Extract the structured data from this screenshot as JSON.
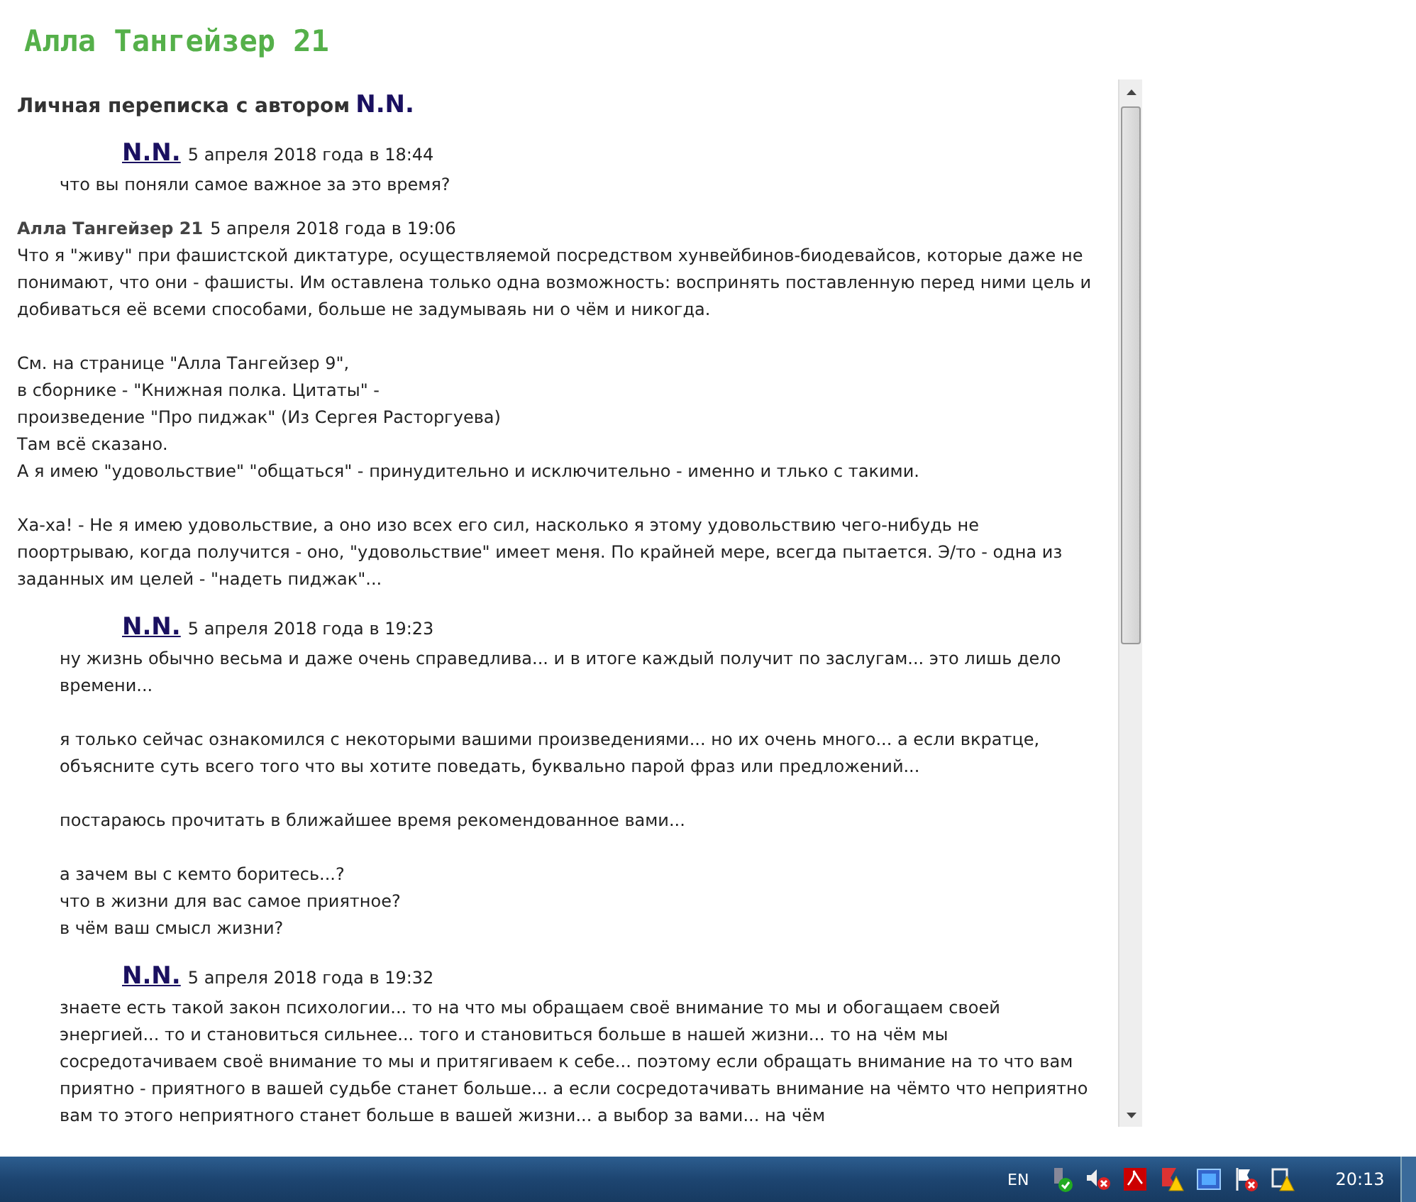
{
  "page_title": "Алла Тангейзер 21",
  "heading": {
    "text": "Личная переписка с автором",
    "author": "N.N."
  },
  "messages": [
    {
      "kind": "reply",
      "author": "N.N.",
      "date": "5 апреля 2018 года в 18:44",
      "paragraphs": [
        [
          "что вы поняли самое важное за это время?"
        ]
      ]
    },
    {
      "kind": "own",
      "author": "Алла Тангейзер 21",
      "date": "5 апреля 2018 года в 19:06",
      "paragraphs": [
        [
          "Что я \"живу\" при фашистской диктатуре, осуществляемой посредством хунвейбинов-биодевайсов, которые даже не понимают, что они - фашисты. Им оставлена только одна возможность: воспринять поставленную перед ними цель и добиваться её всеми способами, больше не задумываяь ни о чём и никогда."
        ],
        [
          "См. на странице \"Алла Тангейзер 9\",",
          "в сборнике - \"Книжная полка. Цитаты\" -",
          "произведение \"Про пиджак\" (Из Сергея Расторгуева)",
          "Там всё сказано.",
          "А я имею \"удовольствие\" \"общаться\" - принудительно и исключительно - именно и тлько с такими."
        ],
        [
          "Ха-ха! - Не я имею удовольствие, а оно изо всех его сил, насколько я этому удовольствию чего-нибудь не поортрываю, когда получится - оно, \"удовольствие\" имеет меня. По крайней мере, всегда пытается. Э/то - одна из заданных им целей - \"надеть пиджак\"..."
        ]
      ]
    },
    {
      "kind": "reply",
      "author": "N.N.",
      "date": "5 апреля 2018 года в 19:23",
      "paragraphs": [
        [
          "ну жизнь обычно весьма и даже очень справедлива... и в итоге каждый получит по заслугам... это лишь дело времени..."
        ],
        [
          "я только сейчас ознакомился с некоторыми вашими произведениями... но их очень много... а если вкратце, объясните суть всего того что вы хотите поведать, буквально парой фраз или предложений..."
        ],
        [
          "постараюсь прочитать в ближайшее время рекомендованное вами..."
        ],
        [
          "а зачем вы с кемто боритесь...?",
          "что в жизни для вас самое приятное?",
          "в чём ваш смысл жизни?"
        ]
      ]
    },
    {
      "kind": "reply",
      "author": "N.N.",
      "date": "5 апреля 2018 года в 19:32",
      "paragraphs": [
        [
          "знаете есть такой закон психологии... то на что мы обращаем своё внимание то мы и обогащаем своей энергией... то и становиться сильнее... того и становиться больше в нашей жизни... то на чём мы сосредотачиваем своё внимание то мы и притягиваем к себе... поэтому если обращать внимание на то что вам приятно - приятного в вашей судьбе станет больше... а если сосредотачивать внимание на чёмто что неприятно вам то этого неприятного станет больше в вашей жизни... а выбор за вами... на чём"
        ]
      ]
    }
  ],
  "taskbar": {
    "language": "EN",
    "clock": "20:13"
  }
}
